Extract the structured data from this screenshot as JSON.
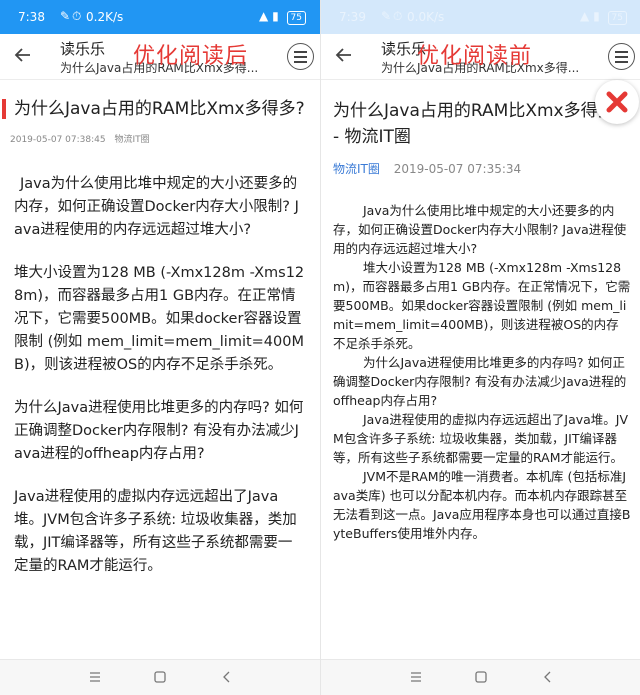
{
  "left": {
    "overlay_label": "优化阅读后",
    "status": {
      "time": "7:38",
      "speed": "0.2K/s",
      "battery": "75"
    },
    "header": {
      "app_name": "读乐乐",
      "subtitle": "为什么Java占用的RAM比Xmx多得..."
    },
    "article": {
      "title": "为什么Java占用的RAM比Xmx多得多?",
      "timestamp": "2019-05-07 07:38:45",
      "source": "物流IT圈",
      "paragraphs": [
        "Java为什么使用比堆中规定的大小还要多的内存，如何正确设置Docker内存大小限制? Java进程使用的内存远远超过堆大小?",
        "堆大小设置为128 MB (-Xmx128m -Xms128m)，而容器最多占用1 GB内存。在正常情况下，它需要500MB。如果docker容器设置限制 (例如 mem_limit=mem_limit=400MB)，则该进程被OS的内存不足杀手杀死。",
        "为什么Java进程使用比堆更多的内存吗? 如何正确调整Docker内存限制? 有没有办法减少Java进程的offheap内存占用?",
        "Java进程使用的虚拟内存远远超出了Java堆。JVM包含许多子系统: 垃圾收集器，类加载，JIT编译器等，所有这些子系统都需要一定量的RAM才能运行。"
      ]
    }
  },
  "right": {
    "overlay_label": "优化阅读前",
    "status": {
      "time": "7:39",
      "speed": "0.0K/s",
      "battery": "75"
    },
    "header": {
      "app_name": "读乐乐",
      "subtitle": "为什么Java占用的RAM比Xmx多得..."
    },
    "article": {
      "title": "为什么Java占用的RAM比Xmx多得多? - 物流IT圈",
      "source": "物流IT圈",
      "timestamp": "2019-05-07 07:35:34",
      "paragraphs": [
        "Java为什么使用比堆中规定的大小还要多的内存，如何正确设置Docker内存大小限制? Java进程使用的内存远远超过堆大小?",
        "堆大小设置为128 MB (-Xmx128m -Xms128m)，而容器最多占用1 GB内存。在正常情况下，它需要500MB。如果docker容器设置限制 (例如 mem_limit=mem_limit=400MB)，则该进程被OS的内存不足杀手杀死。",
        "为什么Java进程使用比堆更多的内存吗? 如何正确调整Docker内存限制? 有没有办法减少Java进程的offheap内存占用?",
        "Java进程使用的虚拟内存远远超出了Java堆。JVM包含许多子系统: 垃圾收集器，类加载，JIT编译器等，所有这些子系统都需要一定量的RAM才能运行。",
        "JVM不是RAM的唯一消费者。本机库 (包括标准Java类库) 也可以分配本机内存。而本机内存跟踪甚至无法看到这一点。Java应用程序本身也可以通过直接ByteBuffers使用堆外内存。"
      ]
    }
  },
  "colors": {
    "accent_red": "#e53935",
    "status_blue": "#2196f3",
    "source_link": "#3b7bd6"
  }
}
